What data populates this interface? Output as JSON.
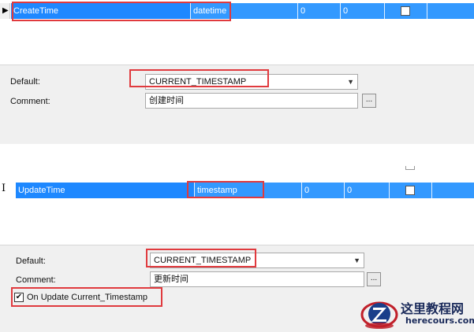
{
  "top": {
    "row": {
      "name": "CreateTime",
      "type": "datetime",
      "length": "0",
      "decimals": "0"
    },
    "default_label": "Default:",
    "default_value": "CURRENT_TIMESTAMP",
    "comment_label": "Comment:",
    "comment_value": "创建时间",
    "ellipsis_label": "..."
  },
  "bottom": {
    "row": {
      "name": "UpdateTime",
      "type": "timestamp",
      "length": "0",
      "decimals": "0"
    },
    "default_label": "Default:",
    "default_value": "CURRENT_TIMESTAMP",
    "comment_label": "Comment:",
    "comment_value": "更新时间",
    "ellipsis_label": "...",
    "on_update_label": "On Update Current_Timestamp",
    "on_update_checked": true
  },
  "watermark": {
    "main": "这里教程网",
    "sub": "herecours.com"
  },
  "colors": {
    "selection": "#3399ff",
    "highlight": "#e03a3e"
  }
}
